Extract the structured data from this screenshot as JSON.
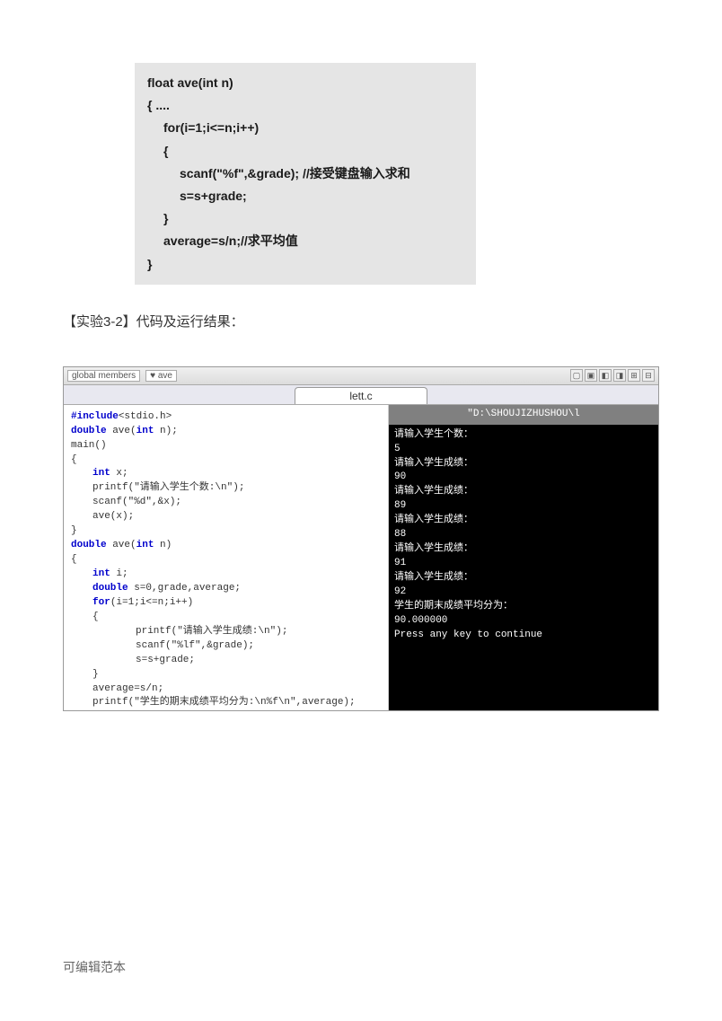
{
  "code1": {
    "l1": "float  ave(int  n)",
    "l2": "{   ....",
    "l3": "for(i=1;i<=n;i++)",
    "l4": "{",
    "l5": "scanf(\"%f\",&grade); //接受键盘输入求和",
    "l6": "s=s+grade;",
    "l7": "}",
    "l8": "average=s/n;//求平均值",
    "l9": "}"
  },
  "section_label": "【实验3-2】代码及运行结果：",
  "ide": {
    "dropdown_label": "global members",
    "dropdown_value": "♥ ave",
    "tab": "lett.c",
    "code": {
      "l1a": "#include",
      "l1b": "<stdio.h>",
      "l2a": "double",
      "l2b": " ave(",
      "l2c": "int",
      "l2d": " n);",
      "l3": "main()",
      "l4": "{",
      "l5a": "int",
      "l5b": " x;",
      "l6": "printf(\"请输入学生个数:\\n\");",
      "l7": "scanf(\"%d\",&x);",
      "l8": "ave(x);",
      "l9": "}",
      "l10a": "double",
      "l10b": " ave(",
      "l10c": "int",
      "l10d": " n)",
      "l11": "{",
      "l12a": "int",
      "l12b": " i;",
      "l13a": "double",
      "l13b": " s=0,grade,average;",
      "l14a": "for",
      "l14b": "(i=1;i<=n;i++)",
      "l15": "{",
      "l16": "printf(\"请输入学生成绩:\\n\");",
      "l17": "scanf(\"%lf\",&grade);",
      "l18": "s=s+grade;",
      "l19": "}",
      "l20": "average=s/n;",
      "l21": "printf(\"学生的期末成绩平均分为:\\n%f\\n\",average);",
      "l22": "}"
    }
  },
  "console": {
    "title": "\"D:\\SHOUJIZHUSHOU\\l",
    "lines": [
      "请输入学生个数：",
      "5",
      "请输入学生成绩：",
      "90",
      "请输入学生成绩：",
      "89",
      "请输入学生成绩：",
      "88",
      "请输入学生成绩：",
      "91",
      "请输入学生成绩：",
      "92",
      "学生的期末成绩平均分为：",
      "90.000000",
      "Press any key to continue"
    ]
  },
  "footer": "可编辑范本"
}
